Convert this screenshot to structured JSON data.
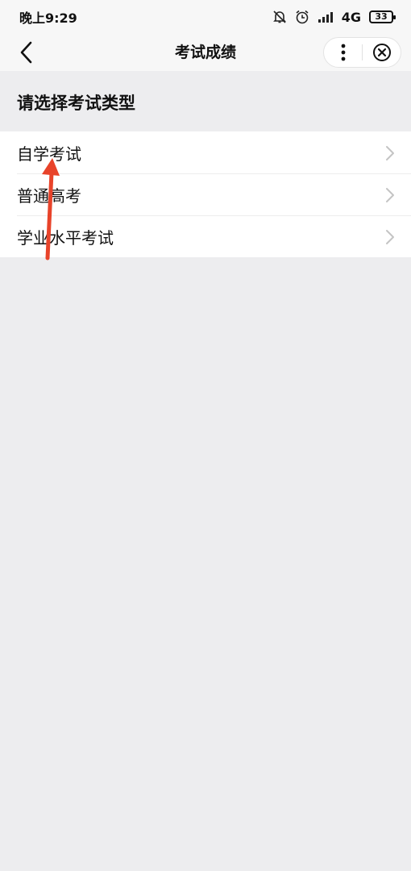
{
  "status_bar": {
    "time": "晚上9:29",
    "network": "4G",
    "battery": "33"
  },
  "nav": {
    "title": "考试成绩"
  },
  "section": {
    "title": "请选择考试类型"
  },
  "exam_types": [
    {
      "label": "自学考试"
    },
    {
      "label": "普通高考"
    },
    {
      "label": "学业水平考试"
    }
  ],
  "colors": {
    "annotation_arrow": "#e8432a",
    "page_bg": "#ededef"
  }
}
